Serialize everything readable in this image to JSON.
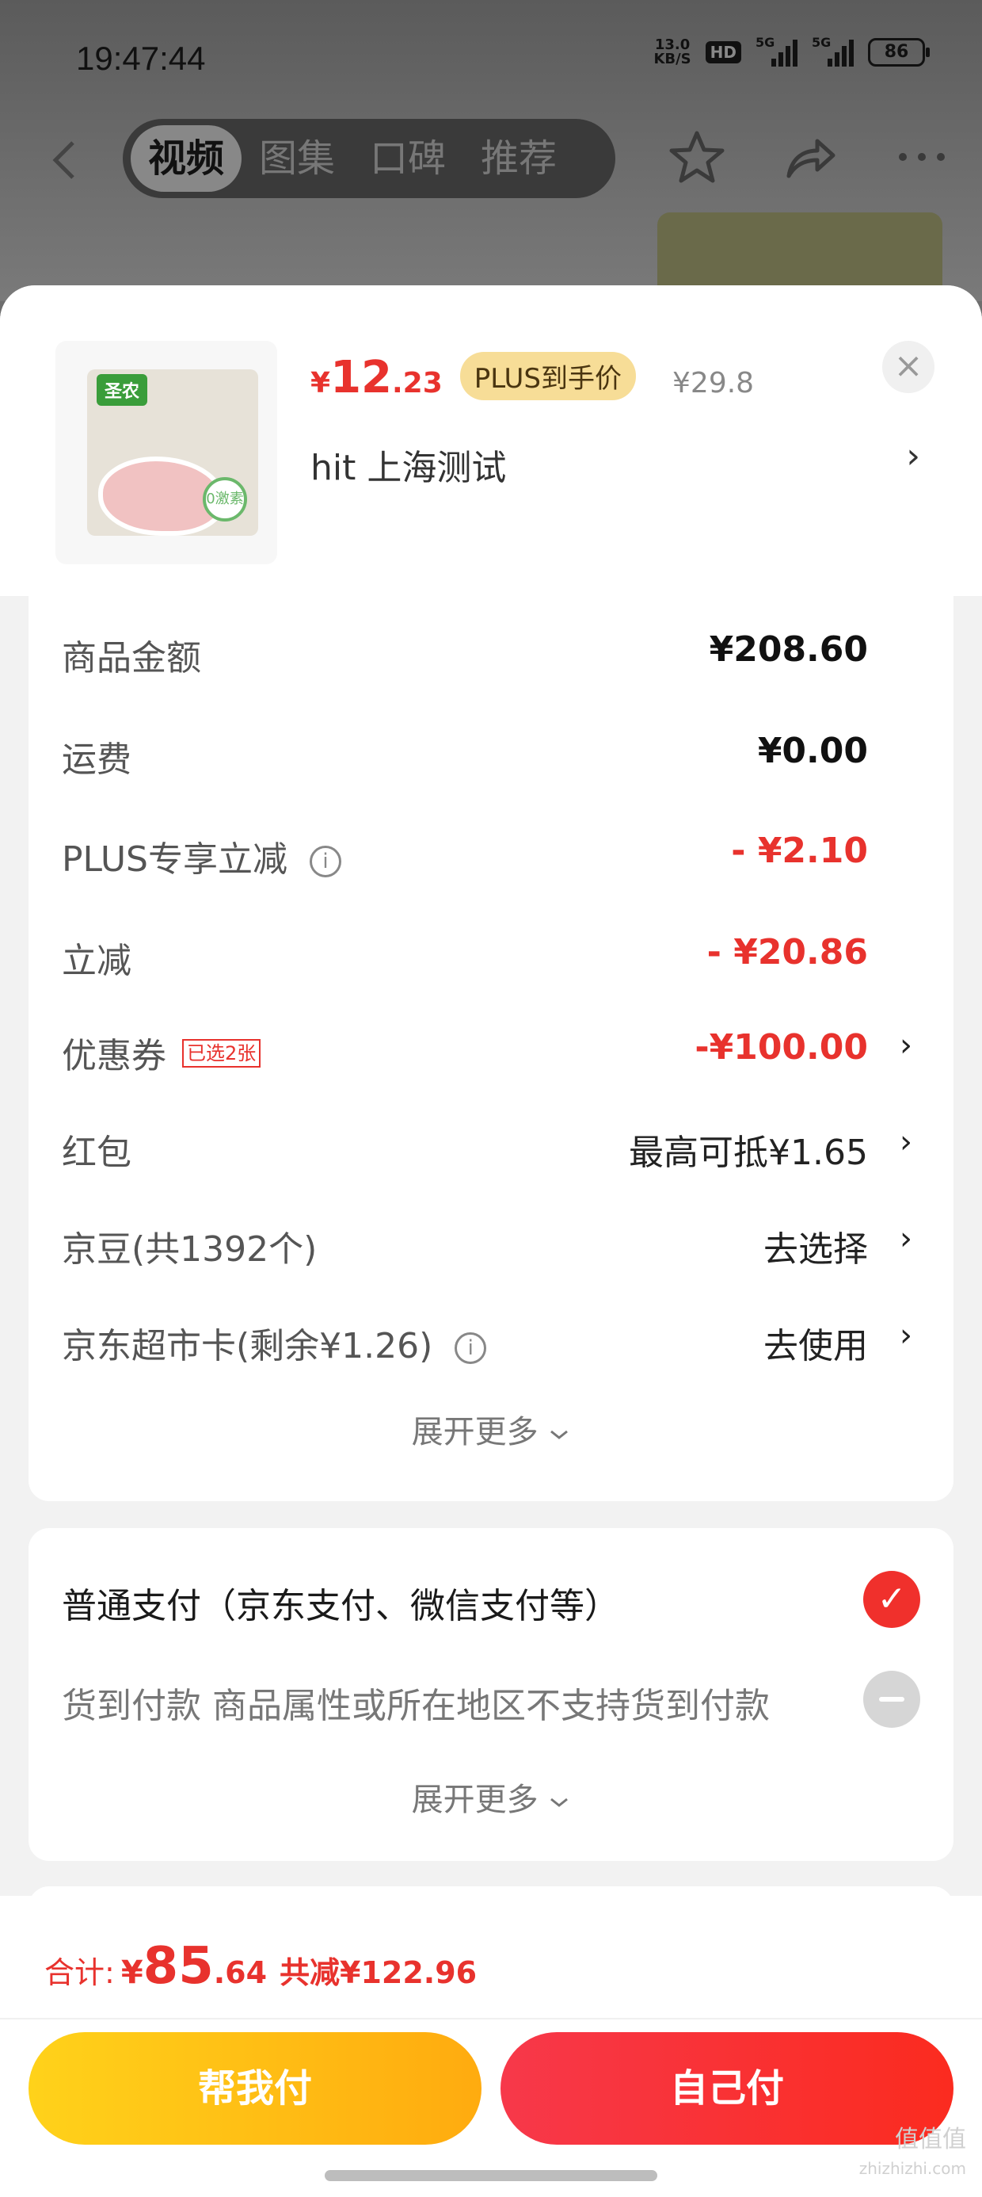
{
  "status": {
    "time": "19:47:44",
    "net_speed": "13.0",
    "net_unit": "KB/S",
    "hd": "HD",
    "sig1": "5G",
    "sig2": "5G",
    "battery": "86"
  },
  "nav": {
    "tabs": [
      "视频",
      "图集",
      "口碑",
      "推荐"
    ],
    "active_tab": 0
  },
  "product": {
    "brand": "圣农",
    "badge": "0激素",
    "price_symbol": "¥",
    "price_int": "12",
    "price_dec": ".23",
    "plus_tag": "PLUS到手价",
    "orig_price": "¥29.8",
    "name": "hit  上海测试",
    "close": "×",
    "arrow": "›"
  },
  "summary": {
    "rows": [
      {
        "label": "商品金额",
        "value": "¥208.60"
      },
      {
        "label": "运费",
        "value": "¥0.00"
      },
      {
        "label": "PLUS专享立减",
        "value": "- ¥2.10"
      },
      {
        "label": "立减",
        "value": "- ¥20.86"
      },
      {
        "label": "优惠券",
        "tag": "已选2张",
        "value": "-¥100.00"
      },
      {
        "label": "红包",
        "value": "最高可抵¥1.65"
      },
      {
        "label": "京豆(共1392个)",
        "value": "去选择"
      },
      {
        "label": "京东超市卡(剩余¥1.26)",
        "value": "去使用"
      }
    ],
    "expand": "展开更多",
    "info_glyph": "i",
    "chev": "›"
  },
  "payment": {
    "normal": "普通支付（京东支付、微信支付等）",
    "cod": "货到付款 商品属性或所在地区不支持货到付款",
    "expand": "展开更多",
    "check": "✓"
  },
  "footer": {
    "total_label": "合计:",
    "yen": "¥",
    "total_int": "85",
    "total_dec": ".64",
    "saved": "共减¥122.96",
    "help_pay": "帮我付",
    "self_pay": "自己付",
    "watermark": "值值值",
    "watermark_url": "zhizhizhi.com"
  },
  "colors": {
    "accent_red": "#e8322d",
    "plus_gold": "#f7dd97",
    "help_btn": "#ffc316",
    "self_btn": "#f7384a"
  }
}
